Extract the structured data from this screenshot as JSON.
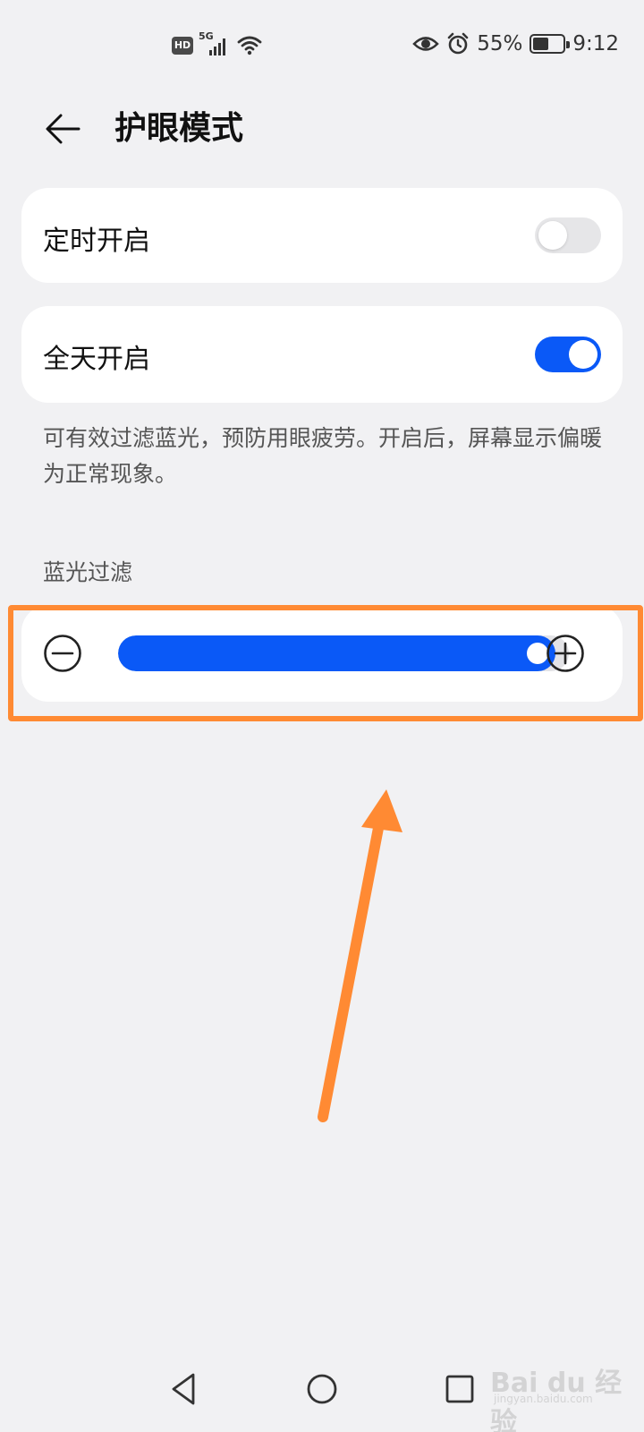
{
  "status_bar": {
    "network_badge": "HD",
    "network_type": "5G",
    "battery_percent": "55%",
    "battery_level": 0.55,
    "time": "9:12",
    "icons": [
      "hd-icon",
      "signal-icon",
      "wifi-icon",
      "eye-comfort-icon",
      "alarm-icon",
      "battery-icon"
    ]
  },
  "header": {
    "title": "护眼模式",
    "back_icon": "arrow-left-icon"
  },
  "settings": {
    "scheduled": {
      "label": "定时开启",
      "enabled": false
    },
    "all_day": {
      "label": "全天开启",
      "enabled": true
    }
  },
  "description": "可有效过滤蓝光，预防用眼疲劳。开启后，屏幕显示偏暖为正常现象。",
  "blue_light_filter": {
    "label": "蓝光过滤",
    "value": 0.97,
    "decrease_icon": "minus-circle-icon",
    "increase_icon": "plus-circle-icon"
  },
  "colors": {
    "accent": "#0a59f7",
    "annotation": "#ff8a33",
    "background": "#f1f1f3"
  },
  "nav_bar": {
    "icons": [
      "back-triangle-icon",
      "home-circle-icon",
      "recents-square-icon"
    ]
  },
  "watermark": {
    "text": "Bai du 经验",
    "sub": "jingyan.baidu.com"
  }
}
